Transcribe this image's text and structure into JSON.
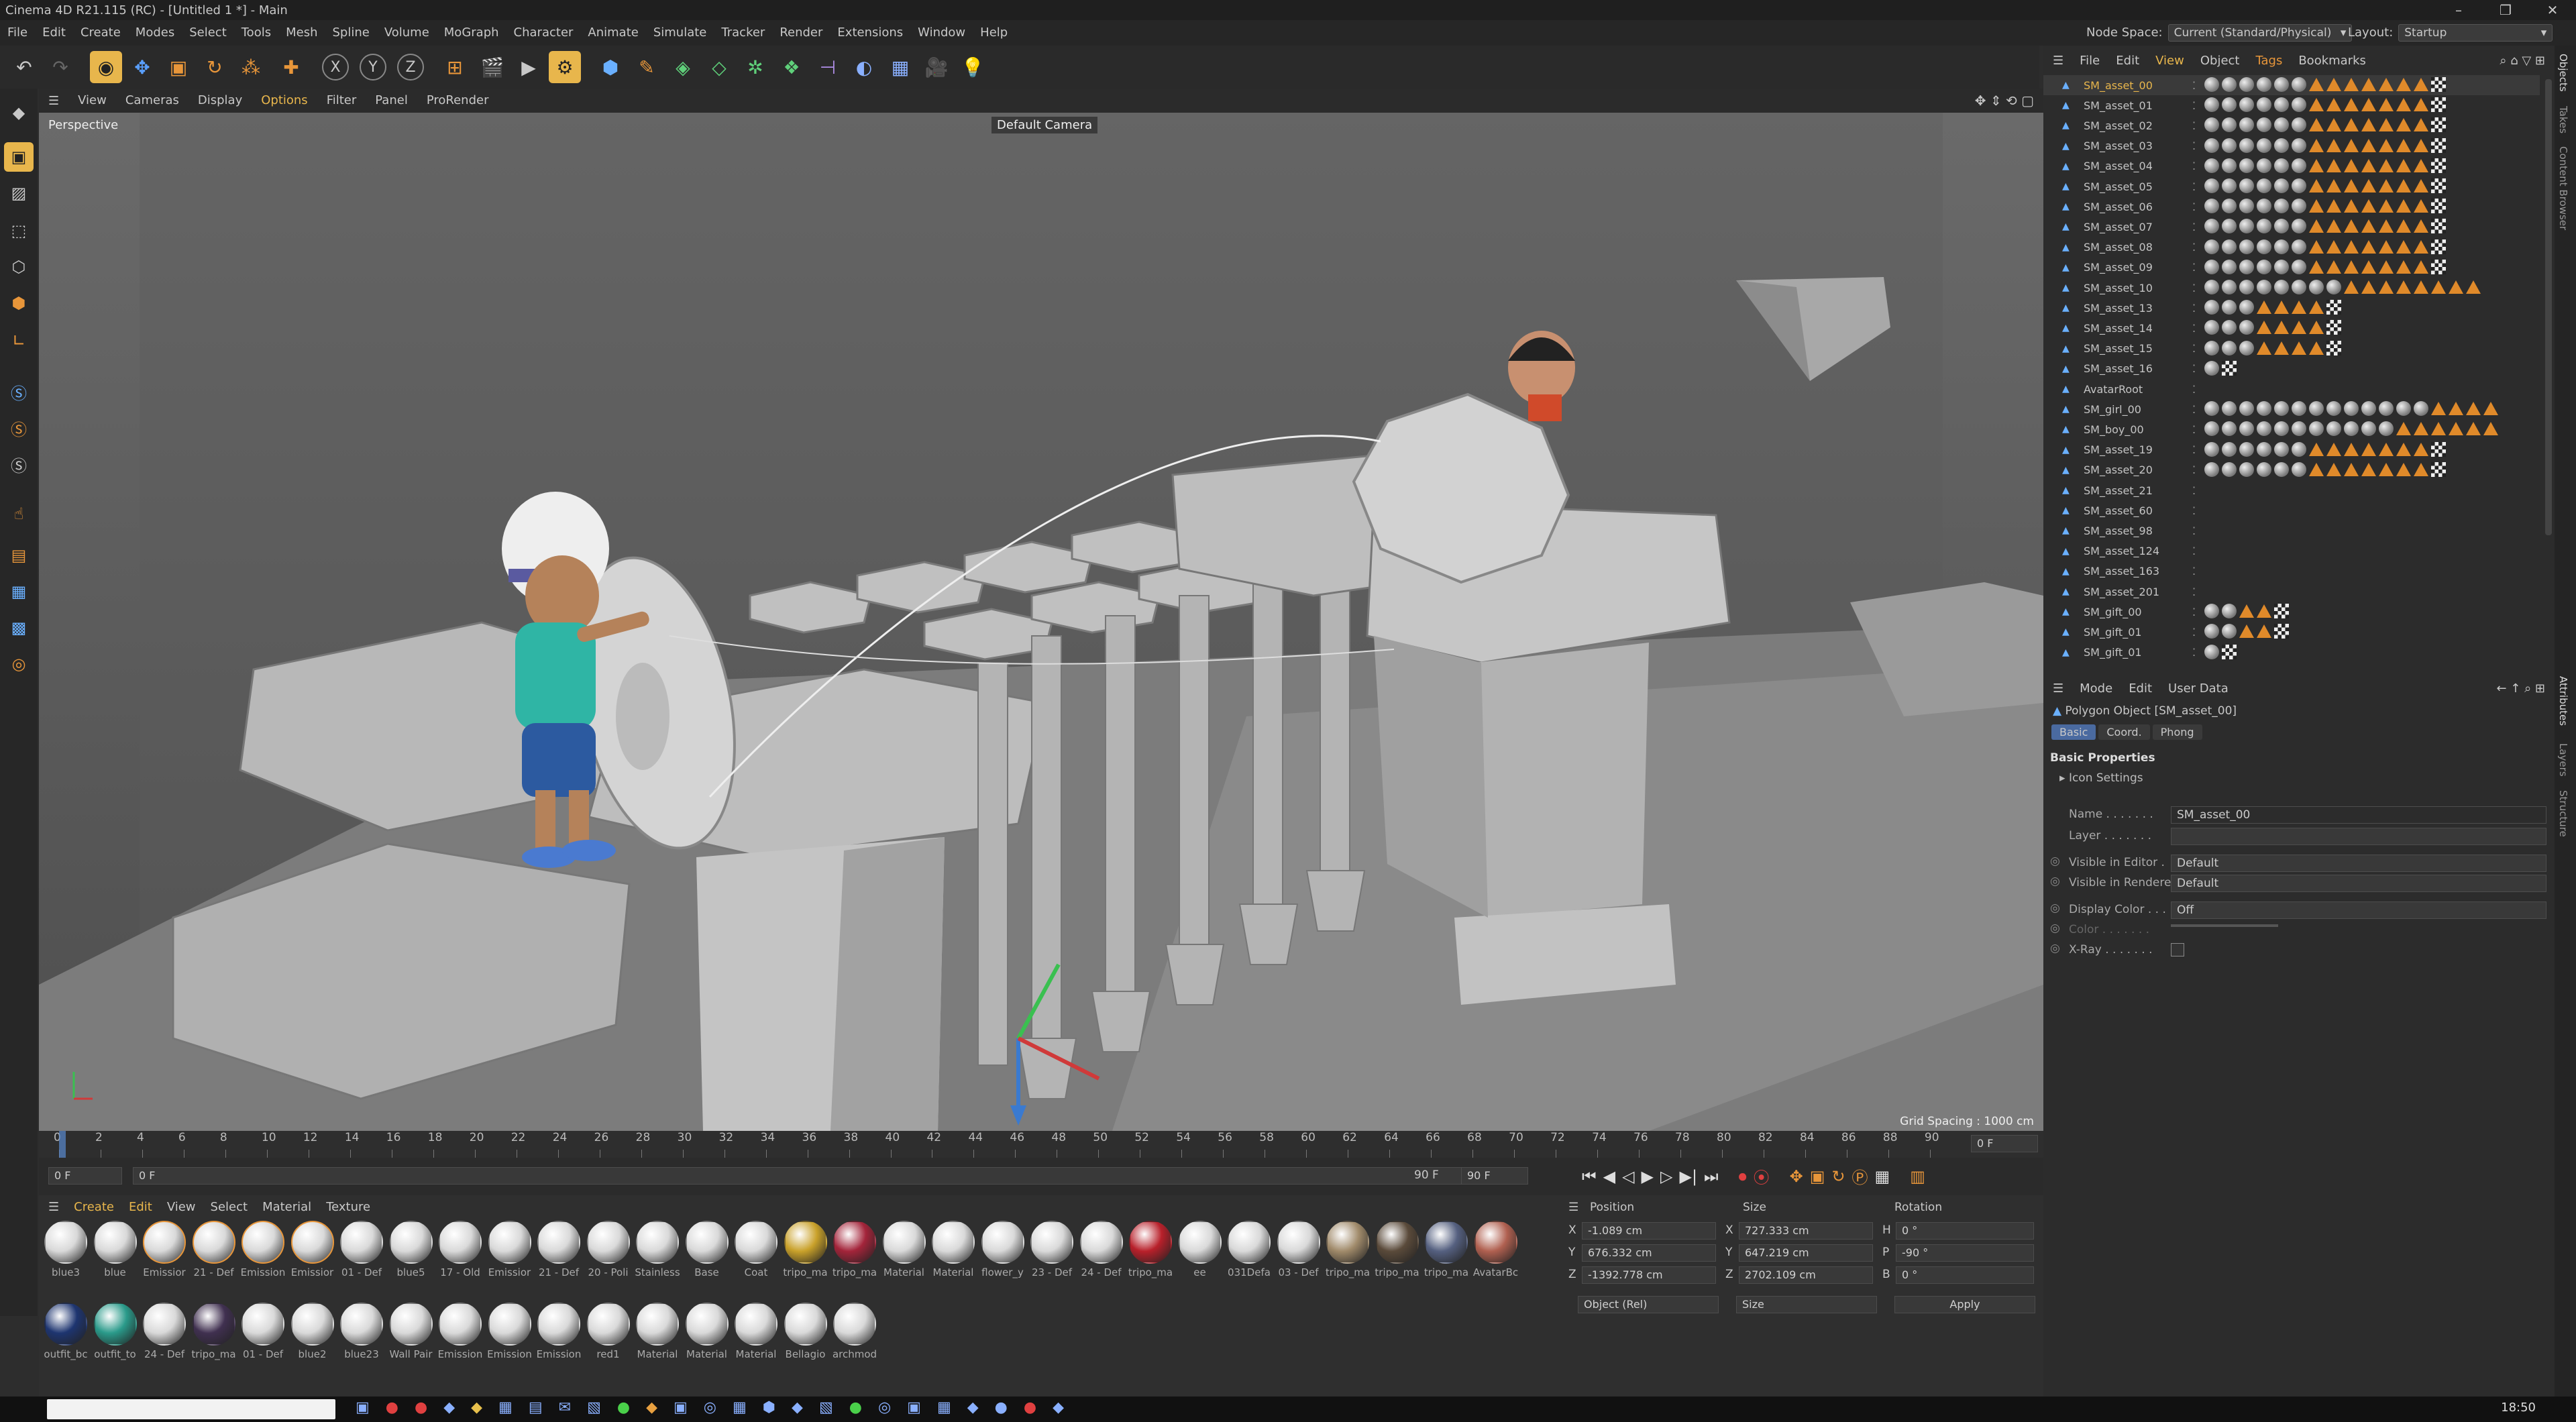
{
  "window": {
    "title": "Cinema 4D R21.115 (RC) - [Untitled 1 *] - Main"
  },
  "menu": [
    "File",
    "Edit",
    "Create",
    "Modes",
    "Select",
    "Tools",
    "Mesh",
    "Spline",
    "Volume",
    "MoGraph",
    "Character",
    "Animate",
    "Simulate",
    "Tracker",
    "Render",
    "Extensions",
    "Window",
    "Help"
  ],
  "header": {
    "node_space_label": "Node Space:",
    "node_space_value": "Current (Standard/Physical)",
    "layout_label": "Layout:",
    "layout_value": "Startup"
  },
  "viewport": {
    "menu": [
      "View",
      "Cameras",
      "Display",
      "Options",
      "Filter",
      "Panel",
      "ProRender"
    ],
    "label": "Perspective",
    "camera": "Default Camera",
    "grid_spacing": "Grid Spacing : 1000 cm"
  },
  "timeline": {
    "ticks": [
      "0",
      "2",
      "4",
      "6",
      "8",
      "10",
      "12",
      "14",
      "16",
      "18",
      "20",
      "22",
      "24",
      "26",
      "28",
      "30",
      "32",
      "34",
      "36",
      "38",
      "40",
      "42",
      "44",
      "46",
      "48",
      "50",
      "52",
      "54",
      "56",
      "58",
      "60",
      "62",
      "64",
      "66",
      "68",
      "70",
      "72",
      "74",
      "76",
      "78",
      "80",
      "82",
      "84",
      "86",
      "88",
      "90"
    ],
    "current_frame": "0 F"
  },
  "transport": {
    "start": "0 F",
    "start2": "0 F",
    "end": "90 F",
    "end2": "90 F"
  },
  "materials": {
    "menu": [
      "Create",
      "Edit",
      "View",
      "Select",
      "Material",
      "Texture"
    ],
    "row1": [
      {
        "name": "blue3",
        "color": "#d9d9d9"
      },
      {
        "name": "blue",
        "color": "#d9d9d9"
      },
      {
        "name": "Emissior",
        "color": "#d9d9d9"
      },
      {
        "name": "21 - Def",
        "color": "#d9d9d9"
      },
      {
        "name": "Emission",
        "color": "#d9d9d9"
      },
      {
        "name": "Emissior",
        "color": "#d9d9d9"
      },
      {
        "name": "01 - Def",
        "color": "#d9d9d9"
      },
      {
        "name": "blue5",
        "color": "#d9d9d9"
      },
      {
        "name": "17 - Old",
        "color": "#d9d9d9"
      },
      {
        "name": "Emissior",
        "color": "#d9d9d9"
      },
      {
        "name": "21 - Def",
        "color": "#d9d9d9"
      },
      {
        "name": "20 - Poli",
        "color": "#d9d9d9"
      },
      {
        "name": "Stainless",
        "color": "#d9d9d9"
      },
      {
        "name": "Base",
        "color": "#d9d9d9"
      },
      {
        "name": "Coat",
        "color": "#d9d9d9"
      },
      {
        "name": "tripo_ma",
        "color": "#c9a12a"
      },
      {
        "name": "tripo_ma",
        "color": "#a3243a"
      },
      {
        "name": "Material",
        "color": "#d9d9d9"
      },
      {
        "name": "Material",
        "color": "#d9d9d9"
      },
      {
        "name": "flower_y",
        "color": "#d9d9d9"
      },
      {
        "name": "23 - Def",
        "color": "#d9d9d9"
      },
      {
        "name": "24 - Def",
        "color": "#d9d9d9"
      },
      {
        "name": "tripo_ma",
        "color": "#b8202a"
      },
      {
        "name": "ee",
        "color": "#d9d9d9"
      },
      {
        "name": "031Defa",
        "color": "#d9d9d9"
      },
      {
        "name": "03 - Def",
        "color": "#d9d9d9"
      },
      {
        "name": "tripo_ma",
        "color": "#a08a6a"
      },
      {
        "name": "tripo_ma",
        "color": "#5a4a3a"
      },
      {
        "name": "tripo_ma",
        "color": "#556080"
      },
      {
        "name": "AvatarBc",
        "color": "#b06050"
      }
    ],
    "row2": [
      {
        "name": "outfit_bc",
        "color": "#1e3570"
      },
      {
        "name": "outfit_to",
        "color": "#2a9a8a"
      },
      {
        "name": "24 - Def",
        "color": "#d9d9d9"
      },
      {
        "name": "tripo_ma",
        "color": "#403050"
      },
      {
        "name": "01 - Def",
        "color": "#d9d9d9"
      },
      {
        "name": "blue2",
        "color": "#d9d9d9"
      },
      {
        "name": "blue23",
        "color": "#d9d9d9"
      },
      {
        "name": "Wall Pair",
        "color": "#d9d9d9"
      },
      {
        "name": "Emission",
        "color": "#d9d9d9"
      },
      {
        "name": "Emission",
        "color": "#d9d9d9"
      },
      {
        "name": "Emission",
        "color": "#d9d9d9"
      },
      {
        "name": "red1",
        "color": "#d9d9d9"
      },
      {
        "name": "Material",
        "color": "#d9d9d9"
      },
      {
        "name": "Material",
        "color": "#d9d9d9"
      },
      {
        "name": "Material",
        "color": "#d9d9d9"
      },
      {
        "name": "Bellagio",
        "color": "#d9d9d9"
      },
      {
        "name": "archmod",
        "color": "#d9d9d9"
      }
    ]
  },
  "coords": {
    "headers": {
      "position": "Position",
      "size": "Size",
      "rotation": "Rotation"
    },
    "rows": [
      {
        "axis": "X",
        "pos": "-1.089 cm",
        "saxis": "X",
        "size": "727.333 cm",
        "raxis": "H",
        "rot": "0 °"
      },
      {
        "axis": "Y",
        "pos": "676.332 cm",
        "saxis": "Y",
        "size": "647.219 cm",
        "raxis": "P",
        "rot": "-90 °"
      },
      {
        "axis": "Z",
        "pos": "-1392.778 cm",
        "saxis": "Z",
        "size": "2702.109 cm",
        "raxis": "B",
        "rot": "0 °"
      }
    ],
    "mode": "Object (Rel)",
    "size_mode": "Size",
    "apply": "Apply"
  },
  "objects": {
    "menu": [
      "File",
      "Edit",
      "View",
      "Object",
      "Tags",
      "Bookmarks"
    ],
    "items": [
      {
        "name": "SM_asset_00",
        "tags": "mmmmmmtttttttc"
      },
      {
        "name": "SM_asset_01",
        "tags": "mmmmmmtttttttc"
      },
      {
        "name": "SM_asset_02",
        "tags": "mmmmmmtttttttc"
      },
      {
        "name": "SM_asset_03",
        "tags": "mmmmmmtttttttc"
      },
      {
        "name": "SM_asset_04",
        "tags": "mmmmmmtttttttc"
      },
      {
        "name": "SM_asset_05",
        "tags": "mmmmmmtttttttc"
      },
      {
        "name": "SM_asset_06",
        "tags": "mmmmmmtttttttc"
      },
      {
        "name": "SM_asset_07",
        "tags": "mmmmmmtttttttc"
      },
      {
        "name": "SM_asset_08",
        "tags": "mmmmmmtttttttc"
      },
      {
        "name": "SM_asset_09",
        "tags": "mmmmmmtttttttc"
      },
      {
        "name": "SM_asset_10",
        "tags": "mmmmmmmmtttttttt"
      },
      {
        "name": "SM_asset_13",
        "tags": "mmmttttc"
      },
      {
        "name": "SM_asset_14",
        "tags": "mmmttttc"
      },
      {
        "name": "SM_asset_15",
        "tags": "mmmttttc"
      },
      {
        "name": "SM_asset_16",
        "tags": "mc"
      },
      {
        "name": "AvatarRoot",
        "tags": ""
      },
      {
        "name": "SM_girl_00",
        "tags": "mmmmmmmmmmmmmtttt"
      },
      {
        "name": "SM_boy_00",
        "tags": "mmmmmmmmmmmtttttt"
      },
      {
        "name": "SM_asset_19",
        "tags": "mmmmmmtttttttc"
      },
      {
        "name": "SM_asset_20",
        "tags": "mmmmmmtttttttc"
      },
      {
        "name": "SM_asset_21",
        "tags": ""
      },
      {
        "name": "SM_asset_60",
        "tags": ""
      },
      {
        "name": "SM_asset_98",
        "tags": ""
      },
      {
        "name": "SM_asset_124",
        "tags": ""
      },
      {
        "name": "SM_asset_163",
        "tags": ""
      },
      {
        "name": "SM_asset_201",
        "tags": ""
      },
      {
        "name": "SM_gift_00",
        "tags": "mmttc"
      },
      {
        "name": "SM_gift_01",
        "tags": "mmttc"
      },
      {
        "name": "SM_gift_01",
        "tags": "mc"
      }
    ]
  },
  "attributes": {
    "menu": [
      "Mode",
      "Edit",
      "User Data"
    ],
    "object_title": "Polygon Object [SM_asset_00]",
    "tabs": [
      "Basic",
      "Coord.",
      "Phong"
    ],
    "section": "Basic Properties",
    "icon_settings": "Icon Settings",
    "fields": [
      {
        "label": "Name . . . . . . .",
        "value": "SM_asset_00"
      },
      {
        "label": "Layer . . . . . . .",
        "value": ""
      },
      {
        "label": "Visible in Editor .",
        "value": "Default"
      },
      {
        "label": "Visible in Renderer",
        "value": "Default"
      },
      {
        "label": "Display Color . . .",
        "value": "Off"
      },
      {
        "label": "Color . . . . . . .",
        "value": ""
      },
      {
        "label": "X-Ray . . . . . . .",
        "value": ""
      }
    ]
  },
  "side_tabs": [
    "Objects",
    "Takes",
    "Content Browser",
    "Attributes",
    "Layers",
    "Structure"
  ],
  "taskbar_time": "18:50"
}
